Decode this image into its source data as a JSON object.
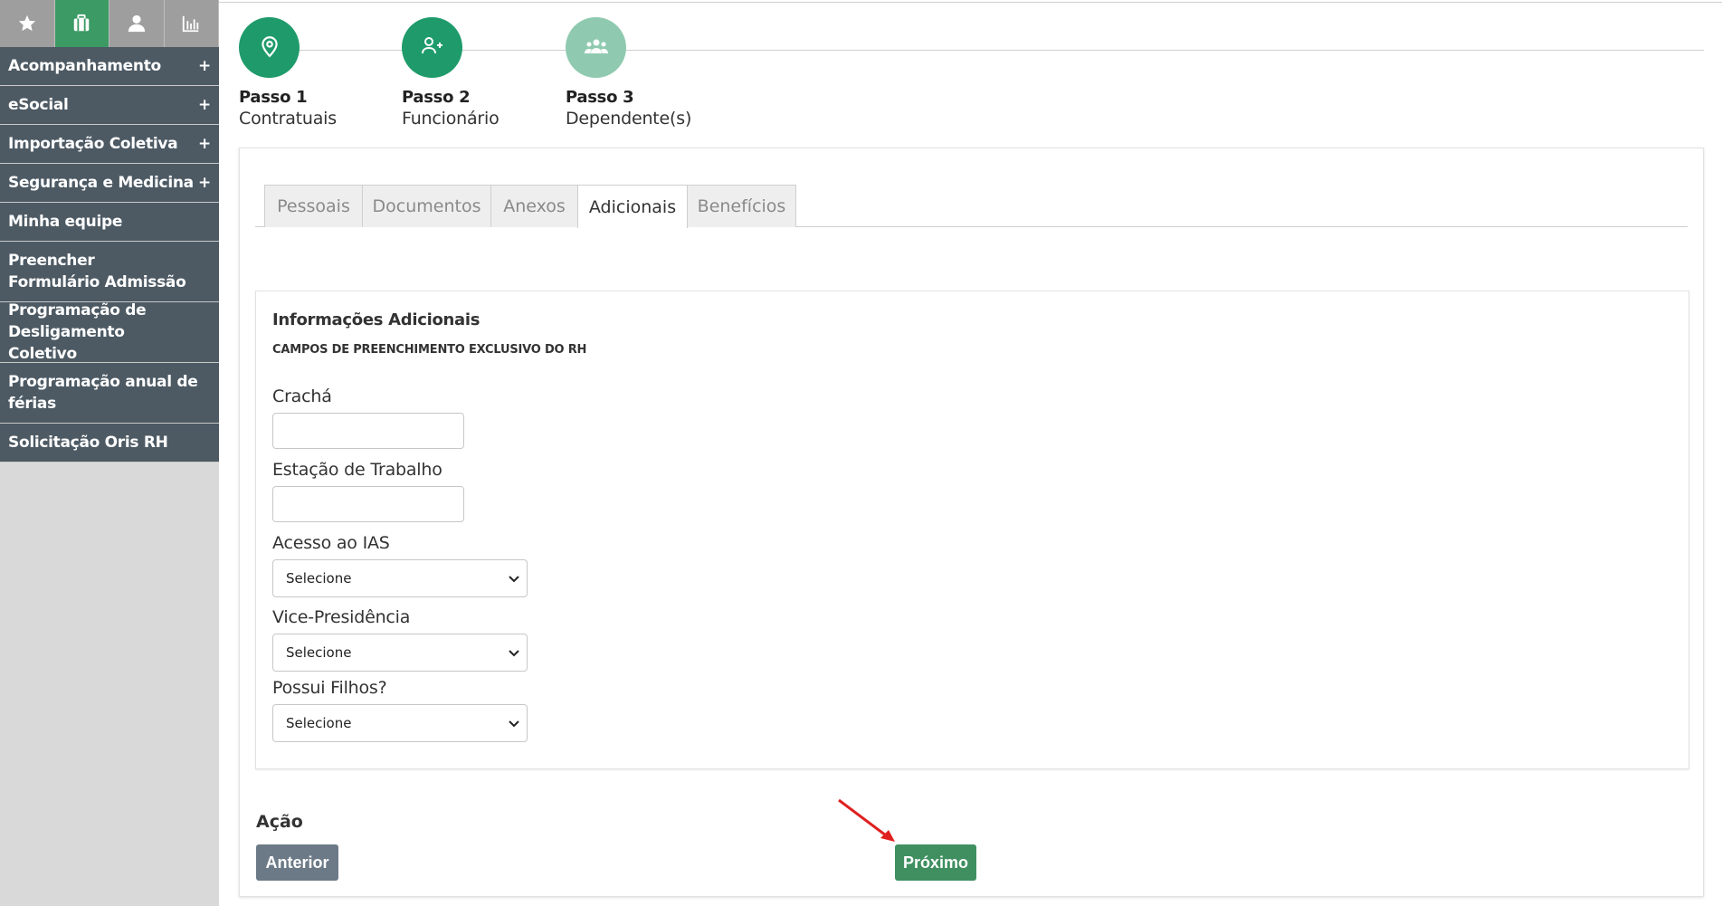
{
  "sidebar": {
    "tabs": [
      {
        "icon": "star-icon",
        "active": false
      },
      {
        "icon": "briefcase-icon",
        "active": true
      },
      {
        "icon": "user-icon",
        "active": false
      },
      {
        "icon": "bar-chart-icon",
        "active": false
      }
    ],
    "items": [
      {
        "label": "Acompanhamento",
        "expandable": "+"
      },
      {
        "label": "eSocial",
        "expandable": "+"
      },
      {
        "label": "Importação Coletiva",
        "expandable": "+"
      },
      {
        "label": "Segurança e Medicina",
        "expandable": "+"
      },
      {
        "label": "Minha equipe"
      },
      {
        "label": "Preencher Formulário Admissão"
      },
      {
        "label": "Programação de Desligamento Coletivo"
      },
      {
        "label": "Programação anual de férias"
      },
      {
        "label": "Solicitação Oris RH"
      }
    ]
  },
  "stepper": {
    "steps": [
      {
        "title": "Passo 1",
        "subtitle": "Contratuais",
        "icon": "location-pin-icon",
        "color": "#1f9b6b"
      },
      {
        "title": "Passo 2",
        "subtitle": "Funcionário",
        "icon": "add-user-icon",
        "color": "#1f9b6b"
      },
      {
        "title": "Passo 3",
        "subtitle": "Dependente(s)",
        "icon": "users-group-icon",
        "color": "#8fcab0"
      }
    ]
  },
  "tabs": [
    {
      "label": "Pessoais",
      "active": false
    },
    {
      "label": "Documentos",
      "active": false
    },
    {
      "label": "Anexos",
      "active": false
    },
    {
      "label": "Adicionais",
      "active": true
    },
    {
      "label": "Benefícios",
      "active": false
    }
  ],
  "form": {
    "title": "Informações Adicionais",
    "subtitle": "CAMPOS DE PREENCHIMENTO EXCLUSIVO DO RH",
    "fields": [
      {
        "label": "Crachá",
        "type": "text",
        "value": ""
      },
      {
        "label": "Estação de Trabalho",
        "type": "text",
        "value": ""
      },
      {
        "label": "Acesso ao IAS",
        "type": "select",
        "value": "Selecione"
      },
      {
        "label": "Vice-Presidência",
        "type": "select",
        "value": "Selecione"
      },
      {
        "label": "Possui Filhos?",
        "type": "select",
        "value": "Selecione"
      }
    ]
  },
  "actions": {
    "title": "Ação",
    "prev_label": "Anterior",
    "next_label": "Próximo"
  },
  "colors": {
    "sidebar_item_bg": "#4d5a64",
    "sidebar_active_tab": "#3c9a64",
    "step_active": "#1f9b6b",
    "step_inactive": "#8fcab0",
    "btn_prev": "#6c7a87",
    "btn_next": "#3f8f60",
    "annotation_arrow": "#e02020"
  }
}
